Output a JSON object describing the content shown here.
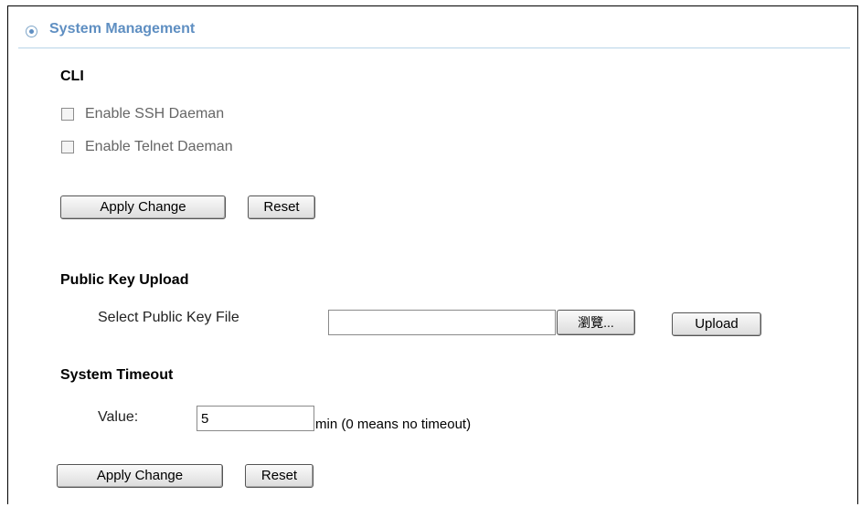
{
  "header": {
    "title": "System Management"
  },
  "cli": {
    "section_title": "CLI",
    "ssh_label": "Enable SSH Daeman",
    "telnet_label": "Enable Telnet Daeman",
    "apply_label": "Apply Change",
    "reset_label": "Reset"
  },
  "public_key": {
    "section_title": "Public Key Upload",
    "select_label": "Select Public Key File",
    "file_value": "",
    "browse_label": "瀏覽...",
    "upload_label": "Upload"
  },
  "timeout": {
    "section_title": "System Timeout",
    "value_label": "Value:",
    "value": "5",
    "hint": "min (0 means no timeout)",
    "apply_label": "Apply Change",
    "reset_label": "Reset"
  }
}
